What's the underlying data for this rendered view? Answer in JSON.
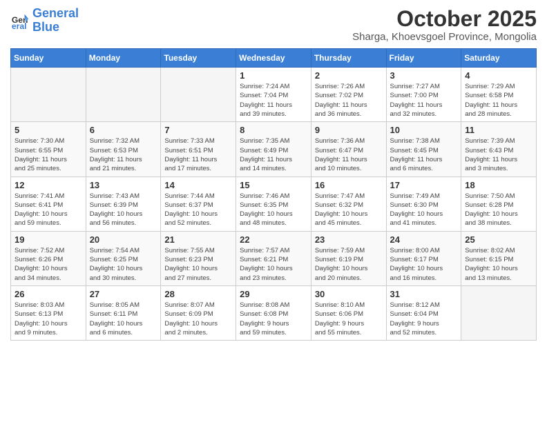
{
  "header": {
    "logo_line1": "General",
    "logo_line2": "Blue",
    "title": "October 2025",
    "subtitle": "Sharga, Khoevsgoel Province, Mongolia"
  },
  "weekdays": [
    "Sunday",
    "Monday",
    "Tuesday",
    "Wednesday",
    "Thursday",
    "Friday",
    "Saturday"
  ],
  "weeks": [
    [
      {
        "day": "",
        "info": ""
      },
      {
        "day": "",
        "info": ""
      },
      {
        "day": "",
        "info": ""
      },
      {
        "day": "1",
        "info": "Sunrise: 7:24 AM\nSunset: 7:04 PM\nDaylight: 11 hours\nand 39 minutes."
      },
      {
        "day": "2",
        "info": "Sunrise: 7:26 AM\nSunset: 7:02 PM\nDaylight: 11 hours\nand 36 minutes."
      },
      {
        "day": "3",
        "info": "Sunrise: 7:27 AM\nSunset: 7:00 PM\nDaylight: 11 hours\nand 32 minutes."
      },
      {
        "day": "4",
        "info": "Sunrise: 7:29 AM\nSunset: 6:58 PM\nDaylight: 11 hours\nand 28 minutes."
      }
    ],
    [
      {
        "day": "5",
        "info": "Sunrise: 7:30 AM\nSunset: 6:55 PM\nDaylight: 11 hours\nand 25 minutes."
      },
      {
        "day": "6",
        "info": "Sunrise: 7:32 AM\nSunset: 6:53 PM\nDaylight: 11 hours\nand 21 minutes."
      },
      {
        "day": "7",
        "info": "Sunrise: 7:33 AM\nSunset: 6:51 PM\nDaylight: 11 hours\nand 17 minutes."
      },
      {
        "day": "8",
        "info": "Sunrise: 7:35 AM\nSunset: 6:49 PM\nDaylight: 11 hours\nand 14 minutes."
      },
      {
        "day": "9",
        "info": "Sunrise: 7:36 AM\nSunset: 6:47 PM\nDaylight: 11 hours\nand 10 minutes."
      },
      {
        "day": "10",
        "info": "Sunrise: 7:38 AM\nSunset: 6:45 PM\nDaylight: 11 hours\nand 6 minutes."
      },
      {
        "day": "11",
        "info": "Sunrise: 7:39 AM\nSunset: 6:43 PM\nDaylight: 11 hours\nand 3 minutes."
      }
    ],
    [
      {
        "day": "12",
        "info": "Sunrise: 7:41 AM\nSunset: 6:41 PM\nDaylight: 10 hours\nand 59 minutes."
      },
      {
        "day": "13",
        "info": "Sunrise: 7:43 AM\nSunset: 6:39 PM\nDaylight: 10 hours\nand 56 minutes."
      },
      {
        "day": "14",
        "info": "Sunrise: 7:44 AM\nSunset: 6:37 PM\nDaylight: 10 hours\nand 52 minutes."
      },
      {
        "day": "15",
        "info": "Sunrise: 7:46 AM\nSunset: 6:35 PM\nDaylight: 10 hours\nand 48 minutes."
      },
      {
        "day": "16",
        "info": "Sunrise: 7:47 AM\nSunset: 6:32 PM\nDaylight: 10 hours\nand 45 minutes."
      },
      {
        "day": "17",
        "info": "Sunrise: 7:49 AM\nSunset: 6:30 PM\nDaylight: 10 hours\nand 41 minutes."
      },
      {
        "day": "18",
        "info": "Sunrise: 7:50 AM\nSunset: 6:28 PM\nDaylight: 10 hours\nand 38 minutes."
      }
    ],
    [
      {
        "day": "19",
        "info": "Sunrise: 7:52 AM\nSunset: 6:26 PM\nDaylight: 10 hours\nand 34 minutes."
      },
      {
        "day": "20",
        "info": "Sunrise: 7:54 AM\nSunset: 6:25 PM\nDaylight: 10 hours\nand 30 minutes."
      },
      {
        "day": "21",
        "info": "Sunrise: 7:55 AM\nSunset: 6:23 PM\nDaylight: 10 hours\nand 27 minutes."
      },
      {
        "day": "22",
        "info": "Sunrise: 7:57 AM\nSunset: 6:21 PM\nDaylight: 10 hours\nand 23 minutes."
      },
      {
        "day": "23",
        "info": "Sunrise: 7:59 AM\nSunset: 6:19 PM\nDaylight: 10 hours\nand 20 minutes."
      },
      {
        "day": "24",
        "info": "Sunrise: 8:00 AM\nSunset: 6:17 PM\nDaylight: 10 hours\nand 16 minutes."
      },
      {
        "day": "25",
        "info": "Sunrise: 8:02 AM\nSunset: 6:15 PM\nDaylight: 10 hours\nand 13 minutes."
      }
    ],
    [
      {
        "day": "26",
        "info": "Sunrise: 8:03 AM\nSunset: 6:13 PM\nDaylight: 10 hours\nand 9 minutes."
      },
      {
        "day": "27",
        "info": "Sunrise: 8:05 AM\nSunset: 6:11 PM\nDaylight: 10 hours\nand 6 minutes."
      },
      {
        "day": "28",
        "info": "Sunrise: 8:07 AM\nSunset: 6:09 PM\nDaylight: 10 hours\nand 2 minutes."
      },
      {
        "day": "29",
        "info": "Sunrise: 8:08 AM\nSunset: 6:08 PM\nDaylight: 9 hours\nand 59 minutes."
      },
      {
        "day": "30",
        "info": "Sunrise: 8:10 AM\nSunset: 6:06 PM\nDaylight: 9 hours\nand 55 minutes."
      },
      {
        "day": "31",
        "info": "Sunrise: 8:12 AM\nSunset: 6:04 PM\nDaylight: 9 hours\nand 52 minutes."
      },
      {
        "day": "",
        "info": ""
      }
    ]
  ]
}
